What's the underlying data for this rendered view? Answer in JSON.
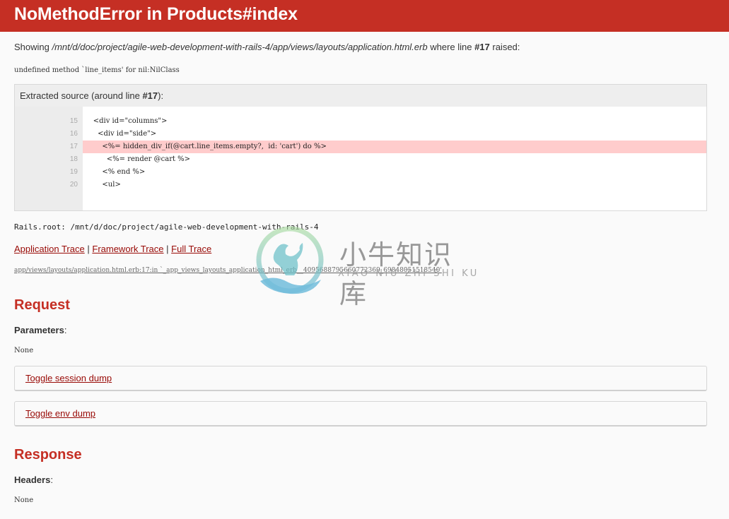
{
  "header": {
    "title": "NoMethodError in Products#index"
  },
  "showing": {
    "prefix": "Showing ",
    "path": "/mnt/d/doc/project/agile-web-development-with-rails-4/app/views/layouts/application.html.erb",
    "middle": " where line ",
    "line": "#17",
    "suffix": " raised:"
  },
  "message": "undefined method `line_items' for nil:NilClass",
  "source": {
    "header_prefix": "Extracted source (around line ",
    "header_line": "#17",
    "header_suffix": "):",
    "lines": [
      {
        "number": "15",
        "code": "    <div id=\"columns\">",
        "highlighted": false
      },
      {
        "number": "16",
        "code": "      <div id=\"side\">",
        "highlighted": false
      },
      {
        "number": "17",
        "code": "        <%= hidden_div_if(@cart.line_items.empty?,  id: 'cart') do %>",
        "highlighted": true
      },
      {
        "number": "18",
        "code": "          <%= render @cart %>",
        "highlighted": false
      },
      {
        "number": "19",
        "code": "        <% end %>",
        "highlighted": false
      },
      {
        "number": "20",
        "code": "        <ul>",
        "highlighted": false
      }
    ]
  },
  "rails_root": "Rails.root: /mnt/d/doc/project/agile-web-development-with-rails-4",
  "traces": {
    "application": "Application Trace",
    "framework": "Framework Trace",
    "full": "Full Trace",
    "separator": "|",
    "line": "app/views/layouts/application.html.erb:17:in `_app_views_layouts_application_html_erb__4095688795660772369_69848051518540'"
  },
  "request": {
    "title": "Request",
    "parameters_label": "Parameters",
    "parameters_value": "None",
    "toggle_session": "Toggle session dump",
    "toggle_env": "Toggle env dump"
  },
  "response": {
    "title": "Response",
    "headers_label": "Headers",
    "headers_value": "None"
  },
  "watermark": {
    "title": "小牛知识库",
    "subtitle": "XIAO NIU ZHI SHI KU"
  },
  "colors": {
    "header_bg": "#c52f24",
    "link": "#980905",
    "highlight": "#ffcccc"
  }
}
